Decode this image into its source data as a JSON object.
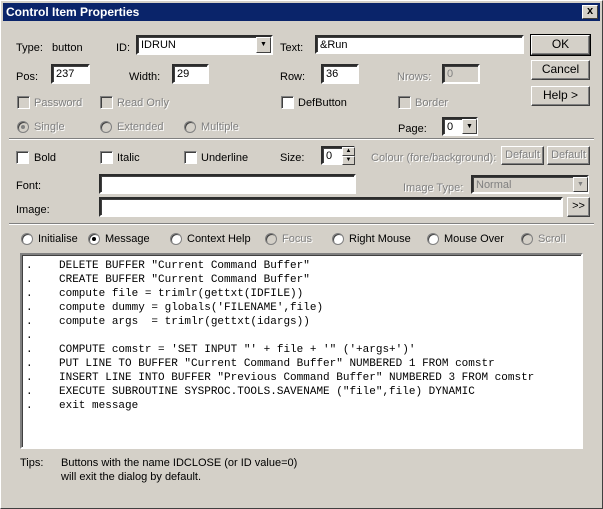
{
  "window": {
    "title": "Control Item Properties",
    "close": "x"
  },
  "props": {
    "type_label": "Type:",
    "type_value": "button",
    "id_label": "ID:",
    "id_value": "IDRUN",
    "text_label": "Text:",
    "text_value": "&Run",
    "pos_label": "Pos:",
    "pos_value": "237",
    "width_label": "Width:",
    "width_value": "29",
    "row_label": "Row:",
    "row_value": "36",
    "nrows_label": "Nrows:",
    "nrows_value": "0",
    "password": "Password",
    "readonly": "Read Only",
    "defbutton": "DefButton",
    "border": "Border",
    "single": "Single",
    "extended": "Extended",
    "multiple": "Multiple",
    "page_label": "Page:",
    "page_value": "0"
  },
  "buttons": {
    "ok": "OK",
    "cancel": "Cancel",
    "help": "Help >",
    "default1": "Default",
    "default2": "Default",
    "browse": ">>"
  },
  "style": {
    "bold": "Bold",
    "italic": "Italic",
    "underline": "Underline",
    "size_label": "Size:",
    "size_value": "0",
    "colour_label": "Colour (fore/background):",
    "font_label": "Font:",
    "image_label": "Image:",
    "image_type_label": "Image Type:",
    "image_type_value": "Normal"
  },
  "events": {
    "initialise": "Initialise",
    "message": "Message",
    "context_help": "Context Help",
    "focus": "Focus",
    "right_mouse": "Right Mouse",
    "mouse_over": "Mouse Over",
    "scroll": "Scroll"
  },
  "code": [
    ".    DELETE BUFFER \"Current Command Buffer\"",
    ".    CREATE BUFFER \"Current Command Buffer\"",
    ".    compute file = trimlr(gettxt(IDFILE))",
    ".    compute dummy = globals('FILENAME',file)",
    ".    compute args  = trimlr(gettxt(idargs))",
    ".",
    ".    COMPUTE comstr = 'SET INPUT \"' + file + '\" ('+args+')'",
    ".    PUT LINE TO BUFFER \"Current Command Buffer\" NUMBERED 1 FROM comstr",
    ".    INSERT LINE INTO BUFFER \"Previous Command Buffer\" NUMBERED 3 FROM comstr",
    ".    EXECUTE SUBROUTINE SYSPROC.TOOLS.SAVENAME (\"file\",file) DYNAMIC",
    ".    exit message"
  ],
  "tips": {
    "label": "Tips:",
    "line1": "Buttons with the name IDCLOSE (or ID value=0)",
    "line2": "will exit the dialog by default."
  }
}
